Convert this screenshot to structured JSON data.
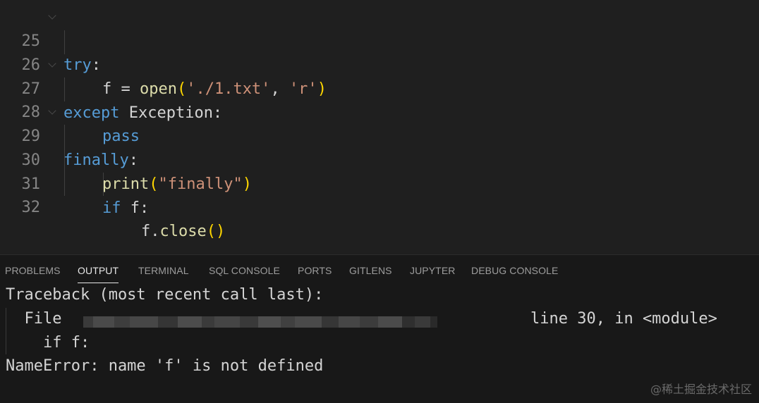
{
  "editor": {
    "lines": [
      {
        "num": "25"
      },
      {
        "num": "26"
      },
      {
        "num": "27"
      },
      {
        "num": "28"
      },
      {
        "num": "29"
      },
      {
        "num": "30"
      },
      {
        "num": "31"
      },
      {
        "num": "32"
      }
    ],
    "code": {
      "l25_kw": "try",
      "l25_colon": ":",
      "l26_f": "f = ",
      "l26_fn": "open",
      "l26_p1": "(",
      "l26_s1": "'./1.txt'",
      "l26_comma": ", ",
      "l26_s2": "'r'",
      "l26_p2": ")",
      "l27_kw": "except",
      "l27_rest": " Exception:",
      "l28_kw": "pass",
      "l29_kw": "finally",
      "l29_colon": ":",
      "l30_fn": "print",
      "l30_p1": "(",
      "l30_s": "\"finally\"",
      "l30_p2": ")",
      "l31_kw": "if",
      "l31_rest": " f:",
      "l32_f": "f.",
      "l32_fn": "close",
      "l32_p": "()"
    }
  },
  "panel": {
    "tabs": [
      "PROBLEMS",
      "OUTPUT",
      "TERMINAL",
      "SQL CONSOLE",
      "PORTS",
      "GITLENS",
      "JUPYTER",
      "DEBUG CONSOLE"
    ],
    "active_tab": "OUTPUT",
    "output": {
      "line1": "Traceback (most recent call last):",
      "line2_start": "  File ",
      "line2_end": "line 30, in <module>",
      "line3": "    if f:",
      "line4": "NameError: name 'f' is not defined"
    }
  },
  "watermark": "@稀土掘金技术社区"
}
